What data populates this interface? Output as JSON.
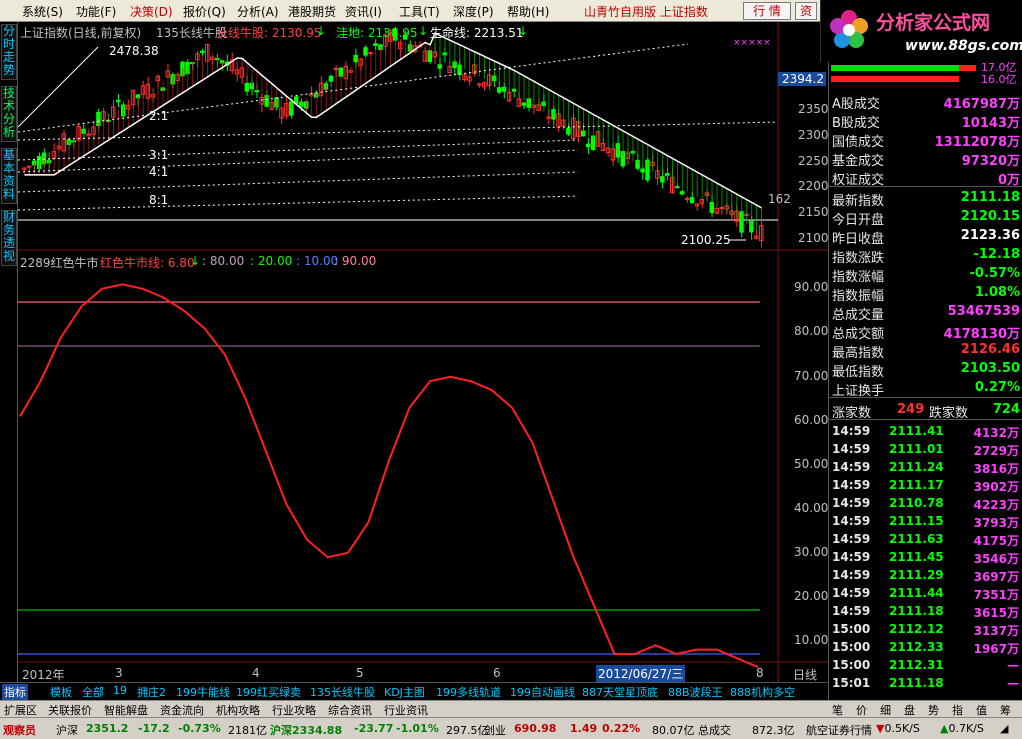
{
  "menu": {
    "items": [
      "系统(S)",
      "功能(F)",
      "决策(D)",
      "报价(Q)",
      "分析(A)",
      "港股期货",
      "资讯(I)",
      "工具(T)",
      "深度(P)",
      "帮助(H)"
    ],
    "title": "山青竹自用版  上证指数",
    "btn_trade": "行 情",
    "btn_info": "资"
  },
  "logo": {
    "text": "分析家公式网",
    "url": "www.88gs.com"
  },
  "left_tabs": [
    "分时走势",
    "技术分析",
    "基本资料",
    "财务透视"
  ],
  "main_header": {
    "name": "上证指数(日线,前复权)",
    "indicator": "135长线牛股",
    "l1": "长线牛股: 2130.95",
    "l1_arrow": "↓",
    "l2": "洼地: 2130.95",
    "l2_arrow": "↓",
    "l3": "生命线: 2213.51",
    "l3_arrow": "↓",
    "marks": "×××××"
  },
  "main_annot": {
    "high": "2478.38",
    "low": "2100.25",
    "ratio_21": "2:1",
    "ratio_31": "3:1",
    "ratio_41": "4:1",
    "ratio_81": "8:1",
    "right_label": "162"
  },
  "main_yaxis": [
    "2394.2",
    "2350",
    "2300",
    "2250",
    "2200",
    "2150",
    "2100"
  ],
  "sub_header": {
    "name": "2289红色牛市",
    "line": "红色牛市线: 6.80",
    "arrow": "↓",
    "v1": ": 80.00",
    "v2": ": 20.00",
    "v3": ": 10.00",
    "v4": ": 90.00"
  },
  "sub_yaxis": [
    "90.00",
    "80.00",
    "70.00",
    "60.00",
    "50.00",
    "40.00",
    "30.00",
    "20.00",
    "10.00"
  ],
  "xaxis": {
    "labels": [
      "2012年",
      "3",
      "4",
      "5",
      "6",
      "8"
    ],
    "cursor": "2012/06/27/三",
    "period": "日线"
  },
  "chart_data": [
    {
      "type": "candlestick",
      "title": "上证指数(日线,前复权)",
      "ylim": [
        2100,
        2394.2
      ],
      "high": 2478.38,
      "low": 2100.25,
      "series": [
        {
          "name": "长线牛股",
          "last": 2130.95
        },
        {
          "name": "洼地",
          "last": 2130.95
        },
        {
          "name": "生命线",
          "last": 2213.51
        }
      ]
    },
    {
      "type": "line",
      "title": "2289红色牛市",
      "ylim": [
        0,
        100
      ],
      "levels": [
        80,
        20,
        10,
        90
      ],
      "series": [
        {
          "name": "红色牛市线",
          "last": 6.8,
          "values": [
            64,
            72,
            82,
            89,
            93,
            94,
            93,
            91,
            88,
            84,
            78,
            68,
            56,
            44,
            36,
            32,
            33,
            40,
            54,
            66,
            72,
            73,
            72,
            70,
            66,
            58,
            45,
            32,
            21,
            10,
            10,
            12,
            10,
            11,
            11,
            9,
            7
          ]
        }
      ]
    }
  ],
  "quote": {
    "a_vol": {
      "k": "A股成交",
      "v": "4167987万"
    },
    "b_vol": {
      "k": "B股成交",
      "v": "10143万"
    },
    "bond": {
      "k": "国债成交",
      "v": "13112078万"
    },
    "fund": {
      "k": "基金成交",
      "v": "97320万"
    },
    "warrant": {
      "k": "权证成交",
      "v": "0万"
    },
    "last": {
      "k": "最新指数",
      "v": "2111.18"
    },
    "open": {
      "k": "今日开盘",
      "v": "2120.15"
    },
    "prev": {
      "k": "昨日收盘",
      "v": "2123.36"
    },
    "chg": {
      "k": "指数涨跌",
      "v": "-12.18"
    },
    "pct": {
      "k": "指数涨幅",
      "v": "-0.57%"
    },
    "amp": {
      "k": "指数振幅",
      "v": "1.08%"
    },
    "vol": {
      "k": "总成交量",
      "v": "53467539"
    },
    "amt": {
      "k": "总成交额",
      "v": "4178130万"
    },
    "hi": {
      "k": "最高指数",
      "v": "2126.46"
    },
    "lo": {
      "k": "最低指数",
      "v": "2103.50"
    },
    "turn": {
      "k": "上证换手",
      "v": "0.27%"
    },
    "up_k": "涨家数",
    "up_v": "249",
    "dn_k": "跌家数",
    "dn_v": "724"
  },
  "bars_top": {
    "v1": "17.0亿",
    "v2": "16.0亿",
    "fill_green_1": 0.88,
    "fill_red_1": 0.12,
    "fill_red_2": 0.88
  },
  "ticks": [
    {
      "t": "14:59",
      "p": "2111.41",
      "v": "4132万"
    },
    {
      "t": "14:59",
      "p": "2111.01",
      "v": "2729万"
    },
    {
      "t": "14:59",
      "p": "2111.24",
      "v": "3816万"
    },
    {
      "t": "14:59",
      "p": "2111.17",
      "v": "3902万"
    },
    {
      "t": "14:59",
      "p": "2110.78",
      "v": "4223万"
    },
    {
      "t": "14:59",
      "p": "2111.15",
      "v": "3793万"
    },
    {
      "t": "14:59",
      "p": "2111.63",
      "v": "4175万"
    },
    {
      "t": "14:59",
      "p": "2111.45",
      "v": "3546万"
    },
    {
      "t": "14:59",
      "p": "2111.29",
      "v": "3697万"
    },
    {
      "t": "14:59",
      "p": "2111.44",
      "v": "7351万"
    },
    {
      "t": "14:59",
      "p": "2111.18",
      "v": "3615万"
    },
    {
      "t": "15:00",
      "p": "2112.12",
      "v": "3137万"
    },
    {
      "t": "15:00",
      "p": "2112.33",
      "v": "1967万"
    },
    {
      "t": "15:00",
      "p": "2112.31",
      "v": "—"
    },
    {
      "t": "15:01",
      "p": "2111.18",
      "v": "—"
    }
  ],
  "bottom_tabs": [
    "指标",
    "模板",
    "全部",
    "19",
    "拥庄2",
    "199牛能线",
    "199红买绿卖",
    "135长线牛股",
    "KDJ主图",
    "199多线轨道",
    "199自动画线",
    "887天堂星顶底",
    "88B波段王",
    "888机构多空"
  ],
  "bottom_tabs2": [
    "扩展区",
    "关联报价",
    "智能解盘",
    "资金流向",
    "机构攻略",
    "行业攻略",
    "综合资讯",
    "行业资讯"
  ],
  "right_tabs": [
    "笔",
    "价",
    "细",
    "盘",
    "势",
    "指",
    "值",
    "筹"
  ],
  "status": {
    "observer": "观察员",
    "sh": "沪深",
    "sh_v": "2351.2",
    "sh_c": "-17.2",
    "sh_p": "-0.73%",
    "sh_a": "2181亿",
    "sz": "沪深2334.88",
    "sz_c": "-23.77",
    "sz_p": "-1.01%",
    "sz_a": "297.5亿",
    "cy": "创业",
    "cy_v": "690.98",
    "cy_c": "1.49",
    "cy_p": "0.22%",
    "cy_a": "80.07亿",
    "tot": "总成交",
    "tot_v": "872.3亿",
    "broker": "航空证券行情",
    "net1": "0.5K/S",
    "net2": "0.7K/S"
  }
}
